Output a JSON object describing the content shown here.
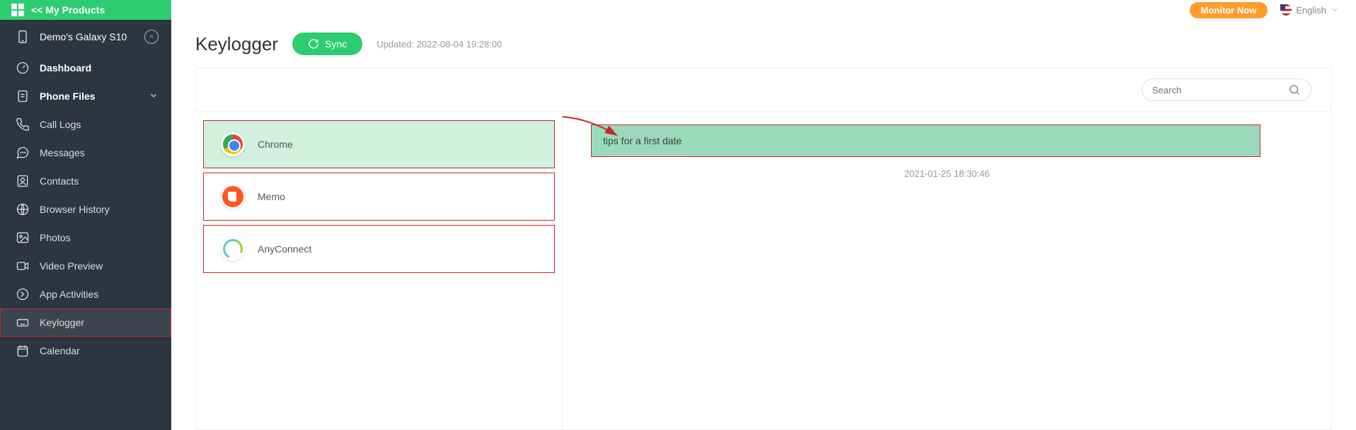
{
  "brand": {
    "my_products": "<<  My Products"
  },
  "topbar": {
    "monitor_now": "Monitor Now",
    "language": "English"
  },
  "device": {
    "name": "Demo's Galaxy S10"
  },
  "nav": {
    "dashboard": "Dashboard",
    "phone_files": "Phone Files",
    "call_logs": "Call Logs",
    "messages": "Messages",
    "contacts": "Contacts",
    "browser_history": "Browser History",
    "photos": "Photos",
    "video_preview": "Video Preview",
    "app_activities": "App Activities",
    "keylogger": "Keylogger",
    "calendar": "Calendar"
  },
  "page": {
    "title": "Keylogger",
    "sync_label": "Sync",
    "updated_prefix": "Updated: ",
    "updated_value": "2022-08-04 19:28:00"
  },
  "search": {
    "placeholder": "Search"
  },
  "apps": [
    {
      "name": "Chrome"
    },
    {
      "name": "Memo"
    },
    {
      "name": "AnyConnect"
    }
  ],
  "log": {
    "entry_text": "tips for a first date",
    "timestamp": "2021-01-25 18:30:46"
  }
}
